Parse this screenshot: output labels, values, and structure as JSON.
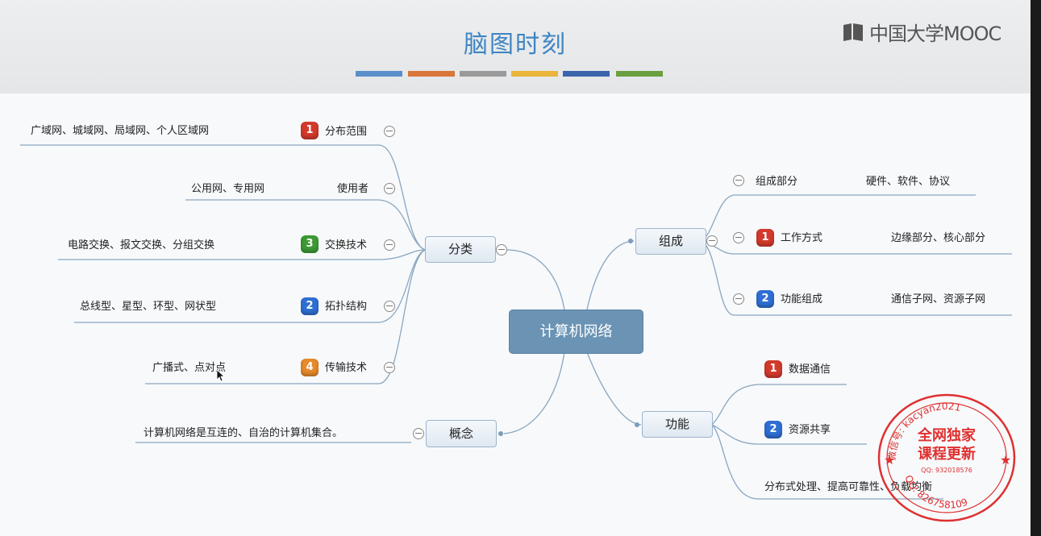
{
  "header": {
    "title": "脑图时刻",
    "logo_text": "中国大学MOOC",
    "color_bars": [
      "#5b8fc9",
      "#d9773a",
      "#9a9a9a",
      "#e9b53a",
      "#3b65ad",
      "#6aa040"
    ]
  },
  "root": {
    "label": "计算机网络"
  },
  "classification": {
    "label": "分类",
    "items": [
      {
        "badge": "1",
        "label": "分布范围",
        "detail": "广域网、城域网、局域网、个人区域网"
      },
      {
        "badge": "",
        "label": "使用者",
        "detail": "公用网、专用网"
      },
      {
        "badge": "3",
        "label": "交换技术",
        "detail": "电路交换、报文交换、分组交换"
      },
      {
        "badge": "2",
        "label": "拓扑结构",
        "detail": "总线型、星型、环型、网状型"
      },
      {
        "badge": "4",
        "label": "传输技术",
        "detail": "广播式、点对点"
      }
    ]
  },
  "concept": {
    "label": "概念",
    "detail": "计算机网络是互连的、自治的计算机集合。"
  },
  "composition": {
    "label": "组成",
    "items": [
      {
        "badge": "",
        "label": "组成部分",
        "detail": "硬件、软件、协议"
      },
      {
        "badge": "1",
        "label": "工作方式",
        "detail": "边缘部分、核心部分"
      },
      {
        "badge": "2",
        "label": "功能组成",
        "detail": "通信子网、资源子网"
      }
    ]
  },
  "function": {
    "label": "功能",
    "items": [
      {
        "badge": "1",
        "label": "数据通信"
      },
      {
        "badge": "2",
        "label": "资源共享"
      },
      {
        "badge": "",
        "label": "分布式处理、提高可靠性、负载均衡"
      }
    ]
  },
  "stamp": {
    "top_text": "微信号: kacyan2021",
    "line1": "全网独家",
    "line2": "课程更新",
    "small": "QQ: 932018576",
    "bottom_text": "QQ: 826758109",
    "color": "#e03030"
  }
}
